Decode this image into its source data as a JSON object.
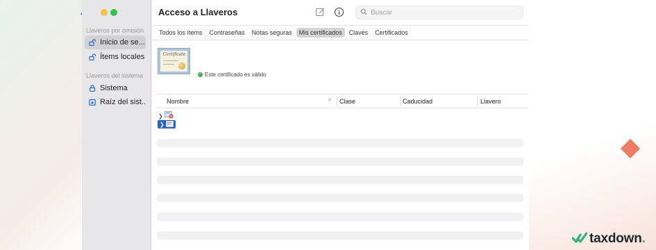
{
  "window": {
    "title": "Acceso a Llaveros"
  },
  "search": {
    "placeholder": "Buscar"
  },
  "sidebar": {
    "default_heading": "Llaveros por omisión",
    "default_items": [
      {
        "label": "Inicio de se...",
        "icon": "unlocked-padlock-icon",
        "selected": true
      },
      {
        "label": "Ítems locales",
        "icon": "unlocked-padlock-icon",
        "selected": false
      }
    ],
    "system_heading": "Llaveros del sistema",
    "system_items": [
      {
        "label": "Sistema",
        "icon": "locked-padlock-icon"
      },
      {
        "label": "Raíz del sist...",
        "icon": "locked-cabinet-icon"
      }
    ]
  },
  "tabs": [
    {
      "label": "Todos los ítems",
      "active": false
    },
    {
      "label": "Contraseñas",
      "active": false
    },
    {
      "label": "Notas seguras",
      "active": false
    },
    {
      "label": "Mis certificados",
      "active": true
    },
    {
      "label": "Claves",
      "active": false
    },
    {
      "label": "Certificados",
      "active": false
    }
  ],
  "certificate": {
    "image_text": "Certificate",
    "status": "Este certificado es válido"
  },
  "table": {
    "columns": [
      "Nombre",
      "Clase",
      "Caducidad",
      "Llavero"
    ],
    "sort_indicator": "^"
  },
  "rows": [
    {
      "icon": "certificate-error-icon",
      "selected": false
    },
    {
      "icon": "certificate-icon",
      "selected": true
    }
  ],
  "brand": {
    "name": "taxdown",
    "dot": "."
  },
  "colors": {
    "accent_blue": "#2562d6",
    "valid_green": "#3cb043",
    "brand_green": "#2db37b",
    "diamond_blue": "#6c79d8",
    "diamond_orange": "#ee7c63"
  }
}
